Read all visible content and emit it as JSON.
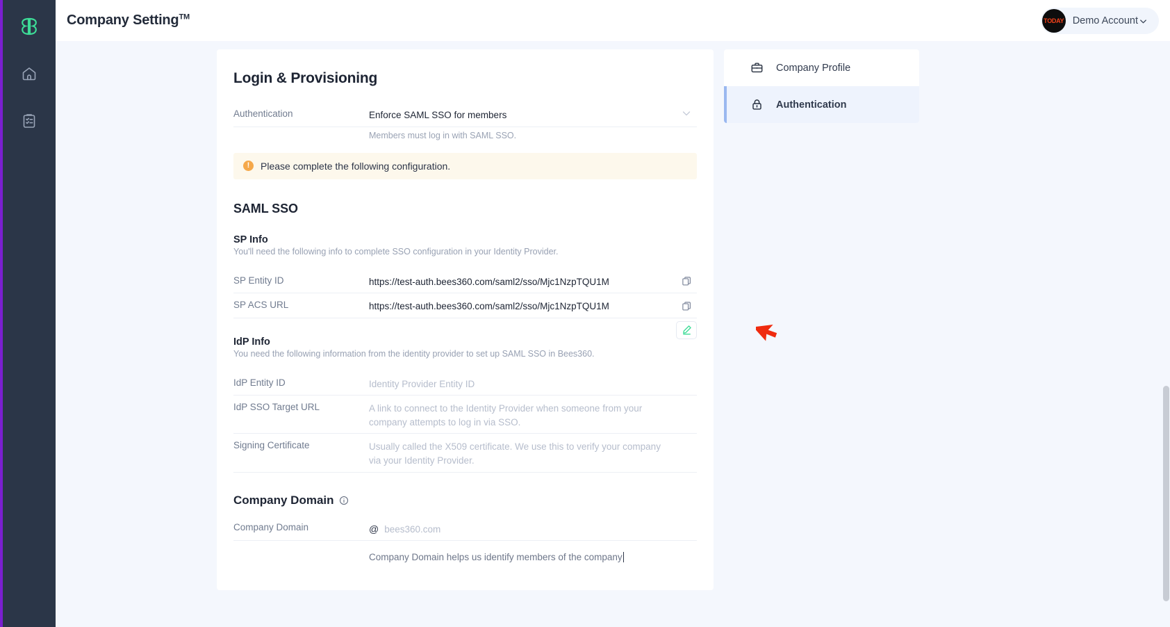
{
  "colors": {
    "rail_bg": "#2b3648",
    "rail_accent": "#7b1fd0",
    "logo_green": "#3ddc97",
    "page_bg": "#f4f7fd",
    "alert_bg": "#fdf8ec",
    "warn_orange": "#f5a84a",
    "active_nav_bg": "#eef3fd",
    "active_nav_bar": "#9ab8f0",
    "cursor_red": "#ef2b0f"
  },
  "rail": {
    "logo_label": "BB",
    "items": [
      {
        "name": "home-icon",
        "label": "Home"
      },
      {
        "name": "clipboard-list-icon",
        "label": "Tasks"
      }
    ]
  },
  "header": {
    "title": "Company Setting",
    "title_sup": "TM",
    "account": {
      "avatar_text": "TODAY",
      "name": "Demo Account",
      "caret": "chevron-down-icon"
    }
  },
  "main": {
    "heading": "Login & Provisioning",
    "authentication": {
      "label": "Authentication",
      "value": "Enforce SAML SSO for members",
      "hint": "Members must log in with SAML SSO."
    },
    "alert": {
      "icon": "warning-circle-icon",
      "text": "Please complete the following configuration."
    },
    "saml_heading": "SAML SSO",
    "sp_info": {
      "title": "SP Info",
      "subtitle": "You'll need the following info to complete SSO configuration in your Identity Provider.",
      "rows": [
        {
          "label": "SP Entity ID",
          "value": "https://test-auth.bees360.com/saml2/sso/Mjc1NzpTQU1M",
          "action": "copy-icon"
        },
        {
          "label": "SP ACS URL",
          "value": "https://test-auth.bees360.com/saml2/sso/Mjc1NzpTQU1M",
          "action": "copy-icon"
        }
      ]
    },
    "idp_info": {
      "title": "IdP Info",
      "subtitle": "You need the following information from the identity provider to set up SAML SSO in Bees360.",
      "edit_icon": "pencil-edit-icon",
      "rows": [
        {
          "label": "IdP Entity ID",
          "placeholder": "Identity Provider Entity ID"
        },
        {
          "label": "IdP SSO Target URL",
          "placeholder": "A link to connect to the Identity Provider when someone from your company attempts to log in via SSO."
        },
        {
          "label": "Signing Certificate",
          "placeholder": "Usually called the X509 certificate. We use this to verify your company via your Identity Provider."
        }
      ]
    },
    "company_domain": {
      "title": "Company Domain",
      "info_icon": "info-circle-icon",
      "row": {
        "label": "Company Domain",
        "prefix": "@",
        "placeholder": "bees360.com"
      },
      "hint": "Company Domain helps us identify members of the company"
    }
  },
  "right_nav": {
    "items": [
      {
        "icon": "briefcase-icon",
        "label": "Company Profile",
        "active": false
      },
      {
        "icon": "lock-icon",
        "label": "Authentication",
        "active": true
      }
    ]
  }
}
